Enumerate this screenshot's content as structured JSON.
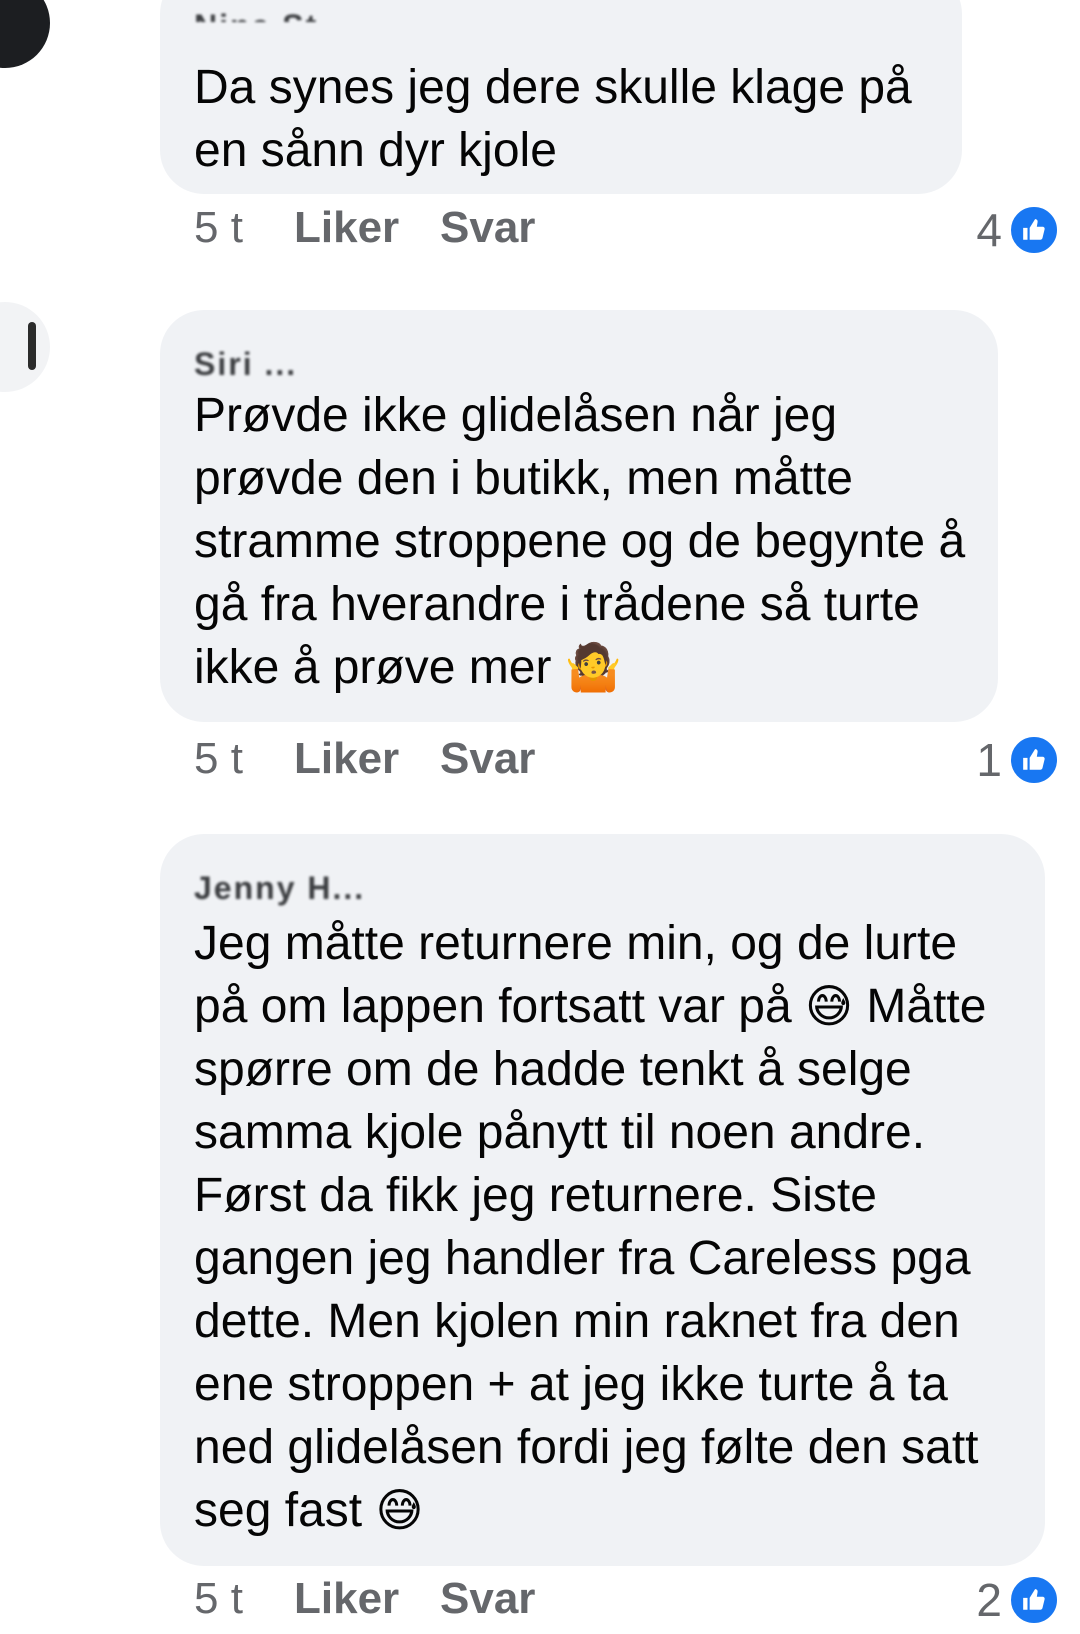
{
  "comments": [
    {
      "author": "Nina St...",
      "text": "Da synes jeg dere skulle klage på en sånn dyr kjole",
      "emoji": "",
      "time": "5 t",
      "like_label": "Liker",
      "reply_label": "Svar",
      "reaction_count": "4"
    },
    {
      "author": "Siri ...",
      "text": "Prøvde ikke glidelåsen når jeg prøvde den i butikk, men måtte stramme stroppene og de begynte å gå fra hverandre i trådene så turte ikke å prøve mer",
      "emoji": "🤷",
      "time": "5 t",
      "like_label": "Liker",
      "reply_label": "Svar",
      "reaction_count": "1"
    },
    {
      "author": "Jenny H...",
      "text_a": "Jeg måtte returnere min, og de lurte på om lappen fortsatt var på",
      "emoji_a": "😅",
      "text_b": "Måtte spørre om de hadde tenkt å selge samma kjole pånytt til noen andre. Først da fikk jeg returnere. Siste gangen jeg handler fra Careless pga dette. Men kjolen min raknet fra den ene stroppen + at jeg ikke turte å ta ned glidelåsen fordi jeg følte den satt seg fast",
      "emoji_b": "😅",
      "time": "5 t",
      "like_label": "Liker",
      "reply_label": "Svar",
      "reaction_count": "2"
    }
  ],
  "icons": {
    "reaction": "like-thumb-icon",
    "reaction_color": "#1877f2"
  }
}
